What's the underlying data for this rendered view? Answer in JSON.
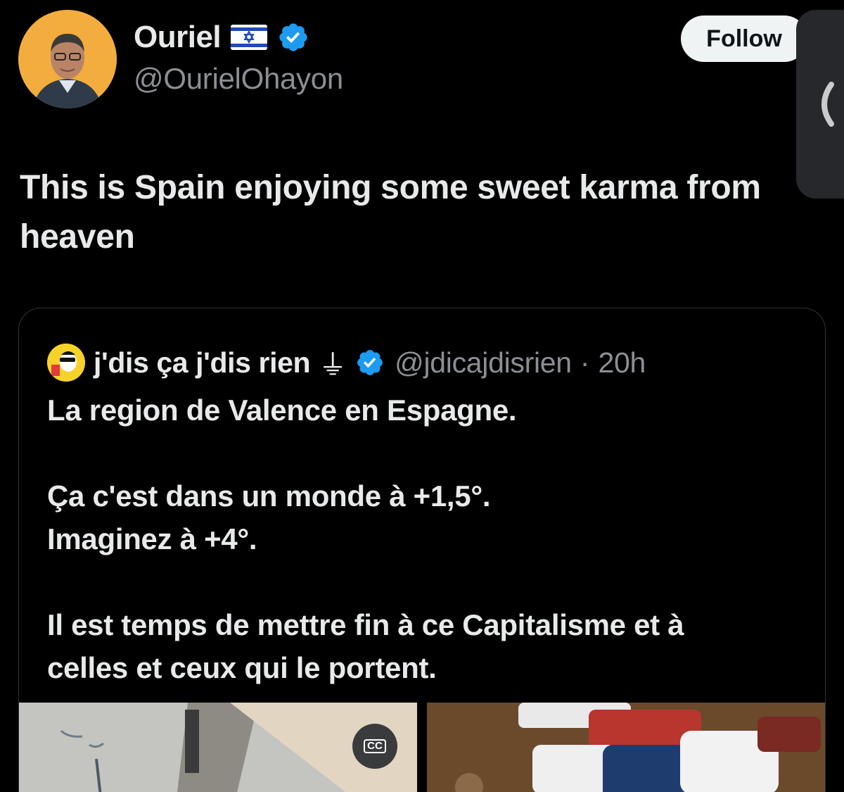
{
  "author": {
    "display_name": "Ouriel",
    "flag_icon": "israel-flag-icon",
    "verified_icon": "verified-badge-icon",
    "handle": "@OurielOhayon",
    "avatar_bg": "#f0a83a"
  },
  "follow_button": {
    "label": "Follow"
  },
  "side_panel": {
    "icon": "chevron-left-icon"
  },
  "tweet": {
    "text": "This is Spain enjoying some sweet karma from heaven"
  },
  "quote": {
    "display_name": "j'dis ça j'dis rien",
    "emoji": "⏚",
    "handle": "@jdicajdisrien",
    "separator": "·",
    "time": "20h",
    "lines": [
      "La region de Valence en Espagne.",
      "",
      "Ça c'est dans un monde à +1,5°.",
      "Imaginez à +4°.",
      "",
      "Il est temps de mettre fin à ce Capitalisme et à",
      "celles et ceux qui le portent."
    ]
  },
  "media": {
    "cc_label": "CC"
  },
  "colors": {
    "background": "#000000",
    "text_primary": "#e7e9ea",
    "text_secondary": "#8b8f94",
    "verified_blue": "#1d9bf0",
    "border": "#2f3336"
  }
}
